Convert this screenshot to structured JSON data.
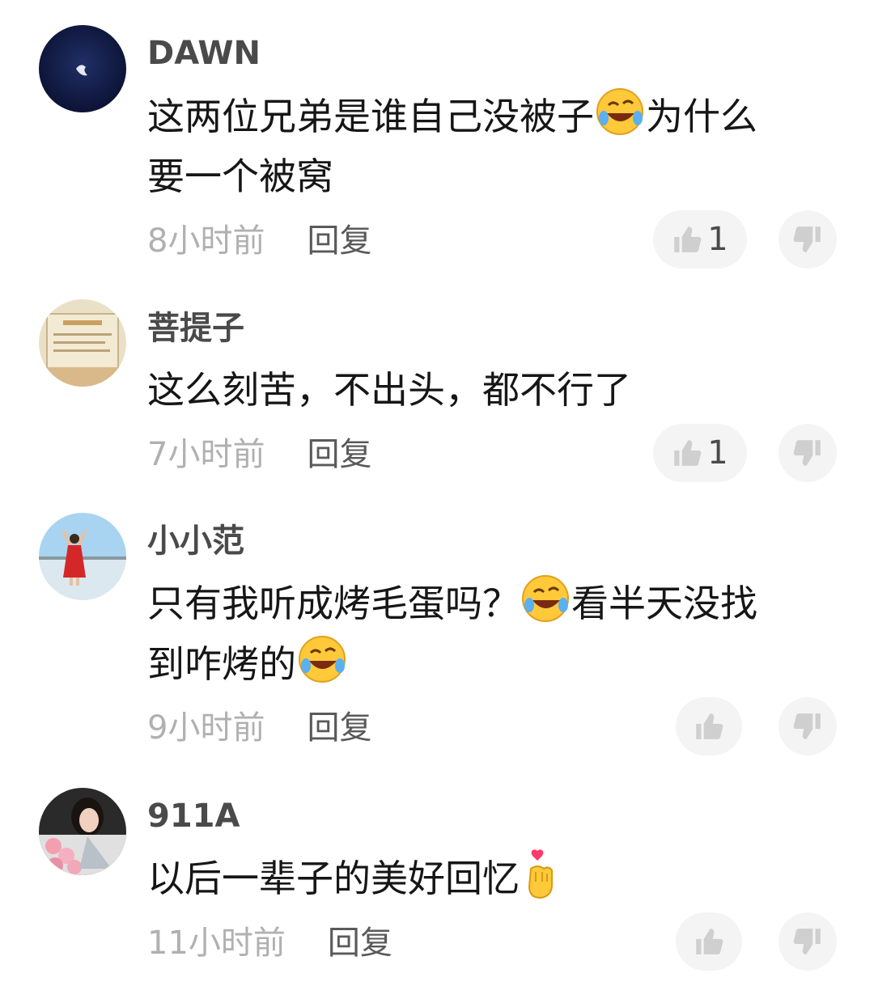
{
  "comments": [
    {
      "username": "DAWN",
      "text_part1": "这两位兄弟是谁自己没被子",
      "emoji1": "laughing-crying-emoji",
      "text_part2": "为什么\n要一个被窝",
      "time": "8小时前",
      "reply_label": "回复",
      "likes": "1"
    },
    {
      "username": "菩提子",
      "text_part1": "这么刻苦，不出头，都不行了",
      "time": "7小时前",
      "reply_label": "回复",
      "likes": "1"
    },
    {
      "username": "小小范",
      "text_part1": "只有我听成烤毛蛋吗？",
      "emoji1": "laughing-crying-emoji",
      "text_part2": "看半天没找\n到咋烤的",
      "emoji2": "laughing-crying-emoji",
      "time": "9小时前",
      "reply_label": "回复",
      "likes": ""
    },
    {
      "username": "911A",
      "text_part1": "以后一辈子的美好回忆",
      "emoji1": "finger-heart-emoji",
      "time": "11小时前",
      "reply_label": "回复",
      "likes": ""
    }
  ],
  "colors": {
    "username": "#4a4a4a",
    "text": "#161616",
    "time": "#b0b0b0",
    "reply": "#5a5a5a",
    "pill_bg": "#f4f4f4"
  }
}
